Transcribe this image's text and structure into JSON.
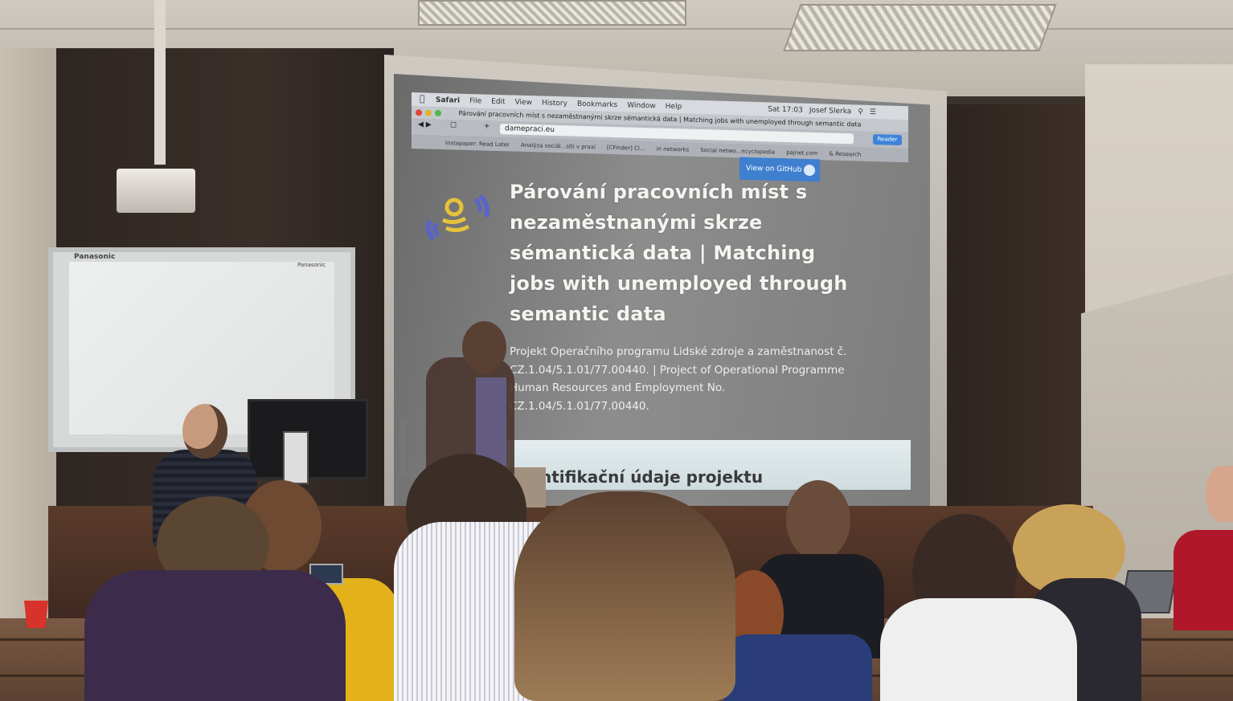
{
  "browser": {
    "menu_items": [
      "Safari",
      "File",
      "Edit",
      "View",
      "History",
      "Bookmarks",
      "Window",
      "Help"
    ],
    "status_clock": "Sat 17:03",
    "status_user": "Josef Slerka",
    "window_title": "Párování pracovních míst s nezaměstnanými skrze sémantická data | Matching jobs with unemployed through semantic data",
    "url": "damepraci.eu",
    "reader_label": "Reader",
    "bookmarks": [
      "Instapaper: Read Later",
      "Analýza sociál...sítí v praxi",
      "[CFinder] Cl...",
      "in networks",
      "Social netwo...ncyclopedia",
      "pajnet.com",
      "& Research"
    ]
  },
  "page": {
    "github_button": "View on GitHub",
    "title": "Párování pracovních míst s nezaměstnanými skrze sémantická data | Matching jobs with unemployed through semantic data",
    "description": "Projekt Operačního programu Lidské zdroje a zaměstnanost č. CZ.1.04/5.1.01/77.00440. | Project of Operational Programme Human Resources and Employment No. CZ.1.04/5.1.01/77.00440.",
    "section_heading": "ntifikační údaje projektu"
  },
  "room": {
    "whiteboard_brand": "Panasonic",
    "whiteboard_brand_right": "Panasonic"
  },
  "colors": {
    "github_button": "#3f7fd0",
    "reader_button": "#3d83d9",
    "screen_text": "#f4f4f0",
    "section_bar": "#dfe8ea"
  }
}
